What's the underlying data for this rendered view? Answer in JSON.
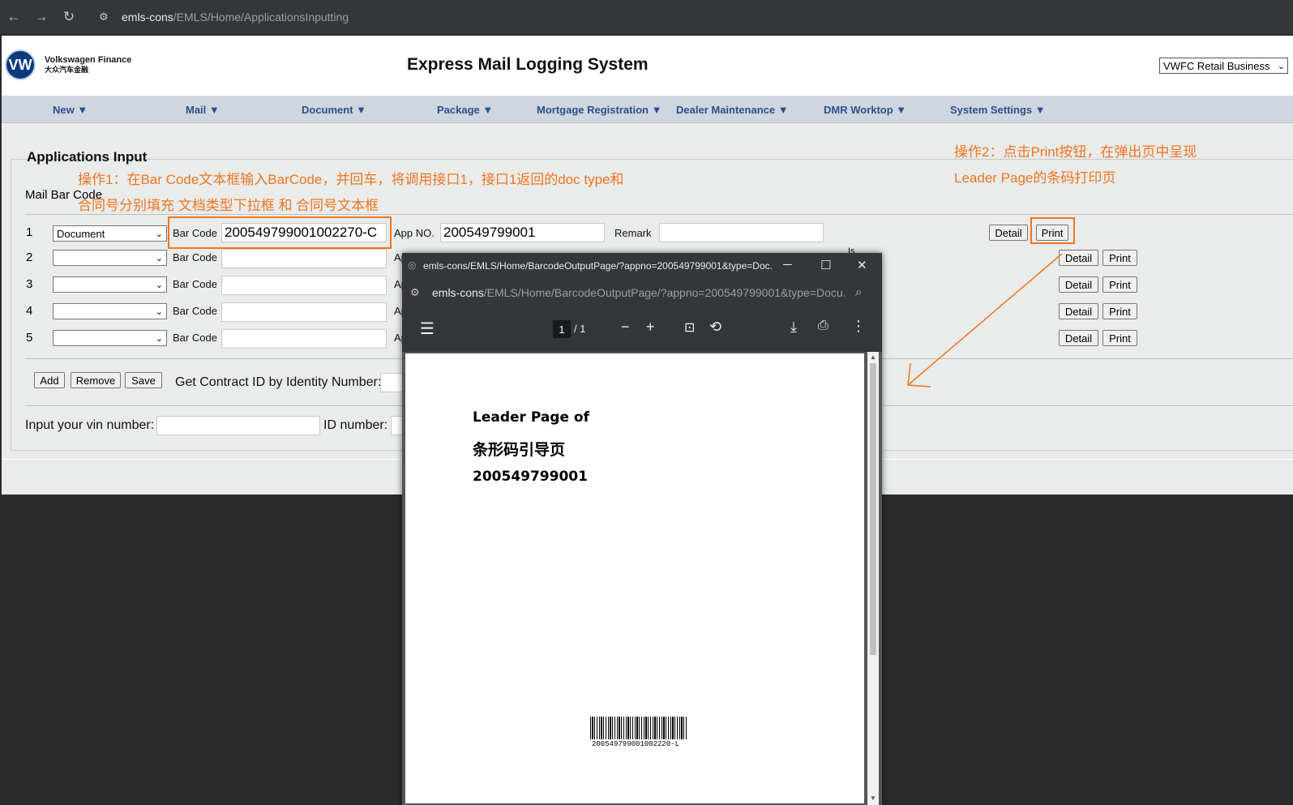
{
  "browser": {
    "back_icon": "←",
    "forward_icon": "→",
    "reload_icon": "↻",
    "site_info_icon": "⚙",
    "url_host": "emls-cons",
    "url_path": "/EMLS/Home/ApplicationsInputting"
  },
  "header": {
    "brand_en": "Volkswagen Finance",
    "brand_cn": "大众汽车金融",
    "logo_text": "VW",
    "title": "Express Mail Logging System",
    "business_select": "VWFC Retail Business"
  },
  "menu": [
    {
      "label": "New ▼"
    },
    {
      "label": "Mail ▼"
    },
    {
      "label": "Document ▼"
    },
    {
      "label": "Package ▼"
    },
    {
      "label": "Mortgage Registration ▼"
    },
    {
      "label": "Dealer Maintenance ▼"
    },
    {
      "label": "DMR Worktop ▼"
    },
    {
      "label": "System Settings ▼"
    }
  ],
  "form": {
    "section_title": "Applications Input",
    "mail_barcode_label": "Mail Bar Code",
    "barcode_label": "Bar Code",
    "appno_label": "App NO.",
    "remark_label": "Remark",
    "is_label": "Is",
    "detail_label": "Detail",
    "print_label": "Print",
    "rows": [
      {
        "num": "1",
        "doc_type": "Document",
        "barcode": "200549799001002270-C",
        "app_no": "200549799001"
      },
      {
        "num": "2",
        "doc_type": "",
        "barcode": "",
        "app_no": "",
        "app_prefix": "Ap"
      },
      {
        "num": "3",
        "doc_type": "",
        "barcode": "",
        "app_no": "",
        "app_prefix": "Ap"
      },
      {
        "num": "4",
        "doc_type": "",
        "barcode": "",
        "app_no": "",
        "app_prefix": "Ap"
      },
      {
        "num": "5",
        "doc_type": "",
        "barcode": "",
        "app_no": "",
        "app_prefix": "Ap"
      }
    ],
    "add_label": "Add",
    "remove_label": "Remove",
    "save_label": "Save",
    "contract_label": "Get Contract ID by Identity Number:",
    "vin_label": "Input your vin number:",
    "id_label": "ID number:"
  },
  "annotations": {
    "step1_line1": "操作1：在Bar Code文本框输入BarCode，并回车，将调用接口1，接口1返回的doc type和",
    "step1_line2": "合同号分别填充 文档类型下拉框 和 合同号文本框",
    "step2_line1": "操作2：点击Print按钮，在弹出页中呈现",
    "step2_line2": "Leader Page的条码打印页",
    "accent_color": "#f07522"
  },
  "popup": {
    "title": "emls-cons/EMLS/Home/BarcodeOutputPage/?appno=200549799001&type=Doc...",
    "url_host": "emls-cons",
    "url_path": "/EMLS/Home/BarcodeOutputPage/?appno=200549799001&type=Docu...",
    "minimize_icon": "─",
    "maximize_icon": "☐",
    "close_icon": "✕",
    "zoom_icon": "⌕",
    "page_current": "1",
    "page_total": "/  1",
    "pdf": {
      "line1": "Leader Page of",
      "line2": "条形码引导页",
      "line3": "200549799001",
      "barcode_text": "200549799001002220-L"
    }
  }
}
